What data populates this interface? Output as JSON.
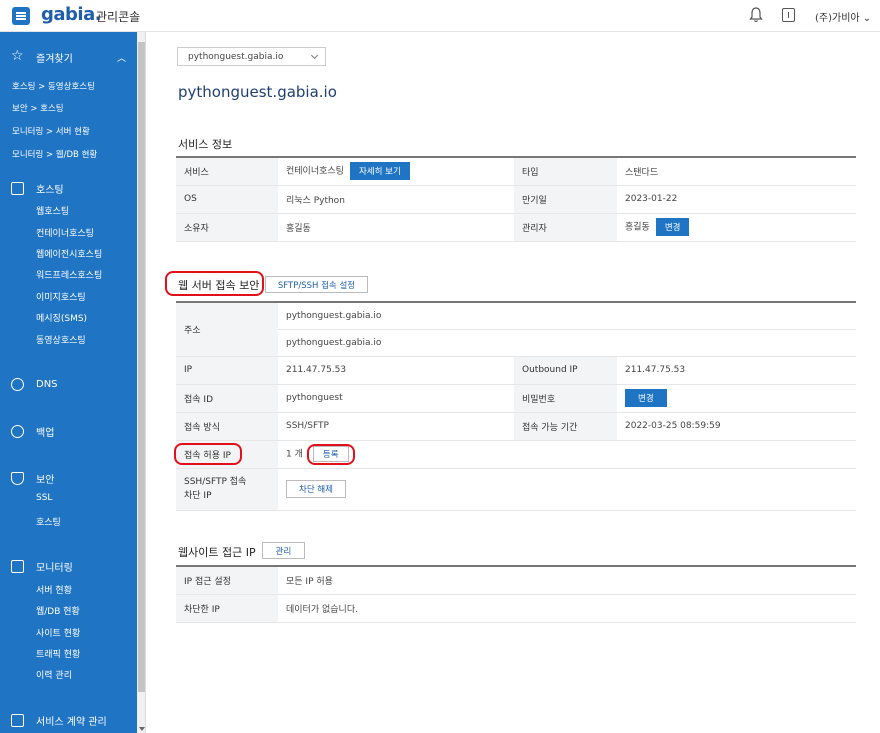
{
  "header": {
    "logo": "gabia.",
    "logo_sub": "관리콘솔",
    "user": "(주)가비아"
  },
  "sidebar": {
    "favorites": {
      "label": "즐겨찾기",
      "links": [
        "호스팅 > 동영상호스팅",
        "보안 > 호스팅",
        "모니터링 > 서버 현황",
        "모니터링 > 웹/DB 현황"
      ]
    },
    "hosting": {
      "label": "호스팅",
      "items": [
        "웹호스팅",
        "컨테이너호스팅",
        "웹에이전시호스팅",
        "워드프레스호스팅",
        "이미지호스팅",
        "메시징(SMS)",
        "동영상호스팅"
      ]
    },
    "dns": {
      "label": "DNS"
    },
    "backup": {
      "label": "백업"
    },
    "security": {
      "label": "보안",
      "items": [
        "SSL",
        "호스팅"
      ]
    },
    "monitoring": {
      "label": "모니터링",
      "items": [
        "서버 현황",
        "웹/DB 현황",
        "사이트 현황",
        "트래픽 현황",
        "이력 관리"
      ]
    },
    "contract": {
      "label": "서비스 계약 관리"
    }
  },
  "main": {
    "domain_select": "pythonguest.gabia.io",
    "domain_title": "pythonguest.gabia.io",
    "service_info": {
      "title": "서비스 정보",
      "rows": [
        {
          "l1": "서비스",
          "v1": "컨테이너호스팅",
          "b1": "자세히 보기",
          "l2": "타입",
          "v2": "스탠다드"
        },
        {
          "l1": "OS",
          "v1": "리눅스 Python",
          "l2": "만기일",
          "v2": "2023-01-22"
        },
        {
          "l1": "소유자",
          "v1": "홍길동",
          "l2": "관리자",
          "v2": "홍길동",
          "b2": "변경"
        }
      ]
    },
    "web_security": {
      "title": "웹 서버 접속 보안",
      "tab_btn": "SFTP/SSH 접속 설정",
      "address_label": "주소",
      "address_values": [
        "pythonguest.gabia.io",
        "pythonguest.gabia.io"
      ],
      "ip_label": "IP",
      "ip_value": "211.47.75.53",
      "outbound_label": "Outbound IP",
      "outbound_value": "211.47.75.53",
      "access_id_label": "접속 ID",
      "access_id_value": "pythonguest",
      "password_label": "비밀번호",
      "password_btn": "변경",
      "method_label": "접속 방식",
      "method_value": "SSH/SFTP",
      "period_label": "접속 가능 기간",
      "period_value": "2022-03-25 08:59:59",
      "allowed_ip_label": "접속 허용 IP",
      "allowed_ip_count": "1 개",
      "allowed_ip_btn": "등록",
      "block_label_1": "SSH/SFTP 접속",
      "block_label_2": "차단 IP",
      "block_btn": "차단 해제"
    },
    "site_ip": {
      "title": "웹사이트 접근 IP",
      "manage_btn": "관리",
      "rows": [
        {
          "label": "IP 접근 설정",
          "value": "모든 IP 허용"
        },
        {
          "label": "차단한 IP",
          "value": "데이터가 없습니다."
        }
      ]
    }
  }
}
